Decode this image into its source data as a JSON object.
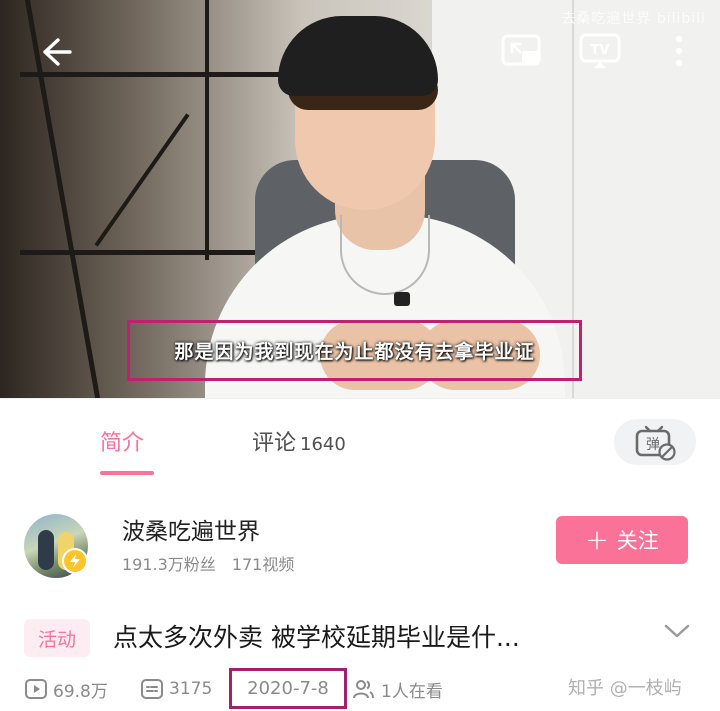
{
  "video": {
    "top_watermark": "去桑吃遍世界 bilibili",
    "subtitle": "那是因为我到现在为止都没有去拿毕业证"
  },
  "tabs": {
    "intro_label": "简介",
    "comment_label": "评论",
    "comment_count": "1640",
    "danmaku_label": "弹"
  },
  "uploader": {
    "name": "波桑吃遍世界",
    "fans": "191.3万粉丝",
    "videos": "171视频",
    "follow_label": "关注"
  },
  "title": {
    "tag": "活动",
    "text": "点太多次外卖 被学校延期毕业是什..."
  },
  "meta": {
    "plays": "69.8万",
    "danmaku": "3175",
    "date": "2020-7-8",
    "watching": "1人在看"
  },
  "watermark": "知乎 @一枝屿",
  "colors": {
    "accent": "#fb7299",
    "highlight_box": "#c0206d"
  }
}
